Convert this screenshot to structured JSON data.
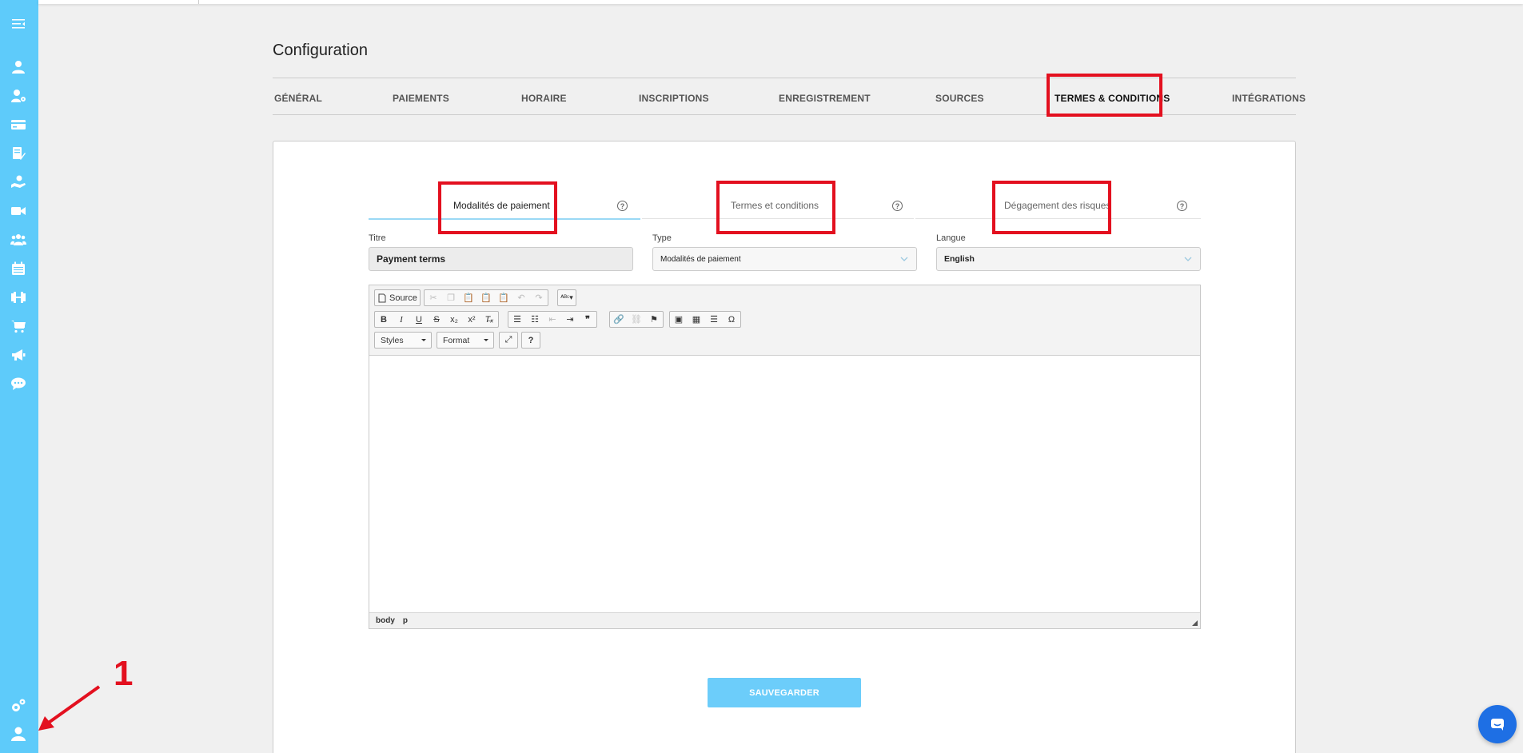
{
  "page": {
    "title": "Configuration"
  },
  "main_tabs": [
    {
      "label": "GÉNÉRAL"
    },
    {
      "label": "PAIEMENTS"
    },
    {
      "label": "HORAIRE"
    },
    {
      "label": "INSCRIPTIONS"
    },
    {
      "label": "ENREGISTREMENT"
    },
    {
      "label": "SOURCES"
    },
    {
      "label": "TERMES & CONDITIONS",
      "active": true
    },
    {
      "label": "INTÉGRATIONS"
    }
  ],
  "sub_tabs": [
    {
      "label": "Modalités de paiement",
      "active": true,
      "help": "?"
    },
    {
      "label": "Termes et conditions",
      "help": "?"
    },
    {
      "label": "Dégagement des risques",
      "help": "?"
    }
  ],
  "form": {
    "title_label": "Titre",
    "title_value": "Payment terms",
    "type_label": "Type",
    "type_value": "Modalités de paiement",
    "language_label": "Langue",
    "language_value": "English"
  },
  "editor": {
    "source_label": "Source",
    "styles_label": "Styles",
    "format_label": "Format",
    "help_label": "?",
    "path": [
      "body",
      "p"
    ]
  },
  "save_label": "SAUVEGARDER",
  "annotation": {
    "number": "1",
    "color": "#e3101f"
  },
  "colors": {
    "sidebar": "#5ecbfa",
    "save_button": "#6ccdfa",
    "chat": "#1e6fe4"
  }
}
